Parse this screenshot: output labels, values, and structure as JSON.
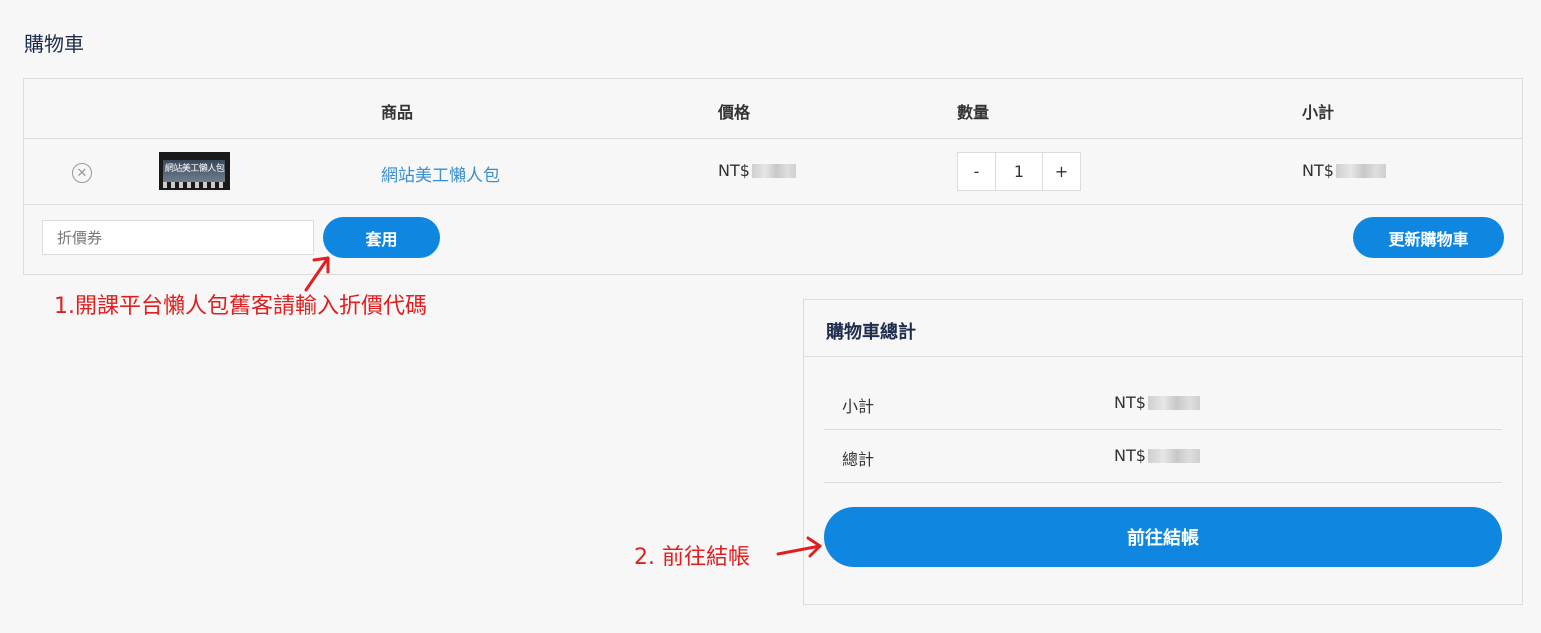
{
  "page": {
    "title": "購物車"
  },
  "cart": {
    "headers": {
      "product": "商品",
      "price": "價格",
      "quantity": "數量",
      "subtotal": "小計"
    },
    "items": [
      {
        "name": "網站美工懶人包",
        "thumbnail_label": "網站美工懶人包",
        "price_prefix": "NT$",
        "quantity": "1",
        "subtotal_prefix": "NT$"
      }
    ],
    "qty_minus": "-",
    "qty_plus": "+",
    "remove_symbol": "✕"
  },
  "coupon": {
    "placeholder": "折價券",
    "apply_label": "套用"
  },
  "update_cart_label": "更新購物車",
  "totals": {
    "title": "購物車總計",
    "subtotal_label": "小計",
    "subtotal_prefix": "NT$",
    "total_label": "總計",
    "total_prefix": "NT$",
    "checkout_label": "前往結帳"
  },
  "annotations": {
    "step1": "1.開課平台懶人包舊客請輸入折價代碼",
    "step2": "2. 前往結帳"
  },
  "colors": {
    "accent": "#0f86e0",
    "link": "#3a8fd0",
    "annotation": "#e02020",
    "title": "#1f2d4d"
  },
  "icons": {
    "remove": "remove-circle-icon",
    "arrow": "arrow-icon"
  }
}
